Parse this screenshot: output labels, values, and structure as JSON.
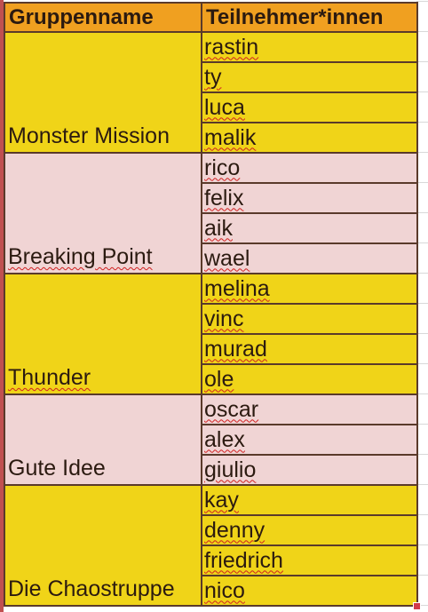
{
  "header": {
    "col1": "Gruppenname",
    "col2": "Teilnehmer*innen"
  },
  "colors": {
    "header_bg": "#f0a020",
    "yellow_group": "#f0d418",
    "pink_group": "#f0d4d4",
    "border": "#5a3a2a",
    "spellcheck": "#d02020"
  },
  "groups": [
    {
      "name": "Monster Mission",
      "color": "#f0d418",
      "spell": false,
      "members": [
        "rastin",
        "ty",
        "luca",
        "malik"
      ]
    },
    {
      "name": "Breaking Point",
      "color": "#f0d4d4",
      "spell": true,
      "members": [
        "rico",
        "felix",
        "aik",
        "wael"
      ]
    },
    {
      "name": "Thunder",
      "color": "#f0d418",
      "spell": true,
      "members": [
        "melina",
        "vinc",
        "murad",
        "ole"
      ]
    },
    {
      "name": "Gute Idee",
      "color": "#f0d4d4",
      "spell": false,
      "members": [
        "oscar",
        "alex",
        "giulio"
      ]
    },
    {
      "name": "Die Chaostruppe",
      "color": "#f0d418",
      "spell": false,
      "members": [
        "kay",
        "denny",
        "friedrich",
        "nico"
      ]
    }
  ]
}
